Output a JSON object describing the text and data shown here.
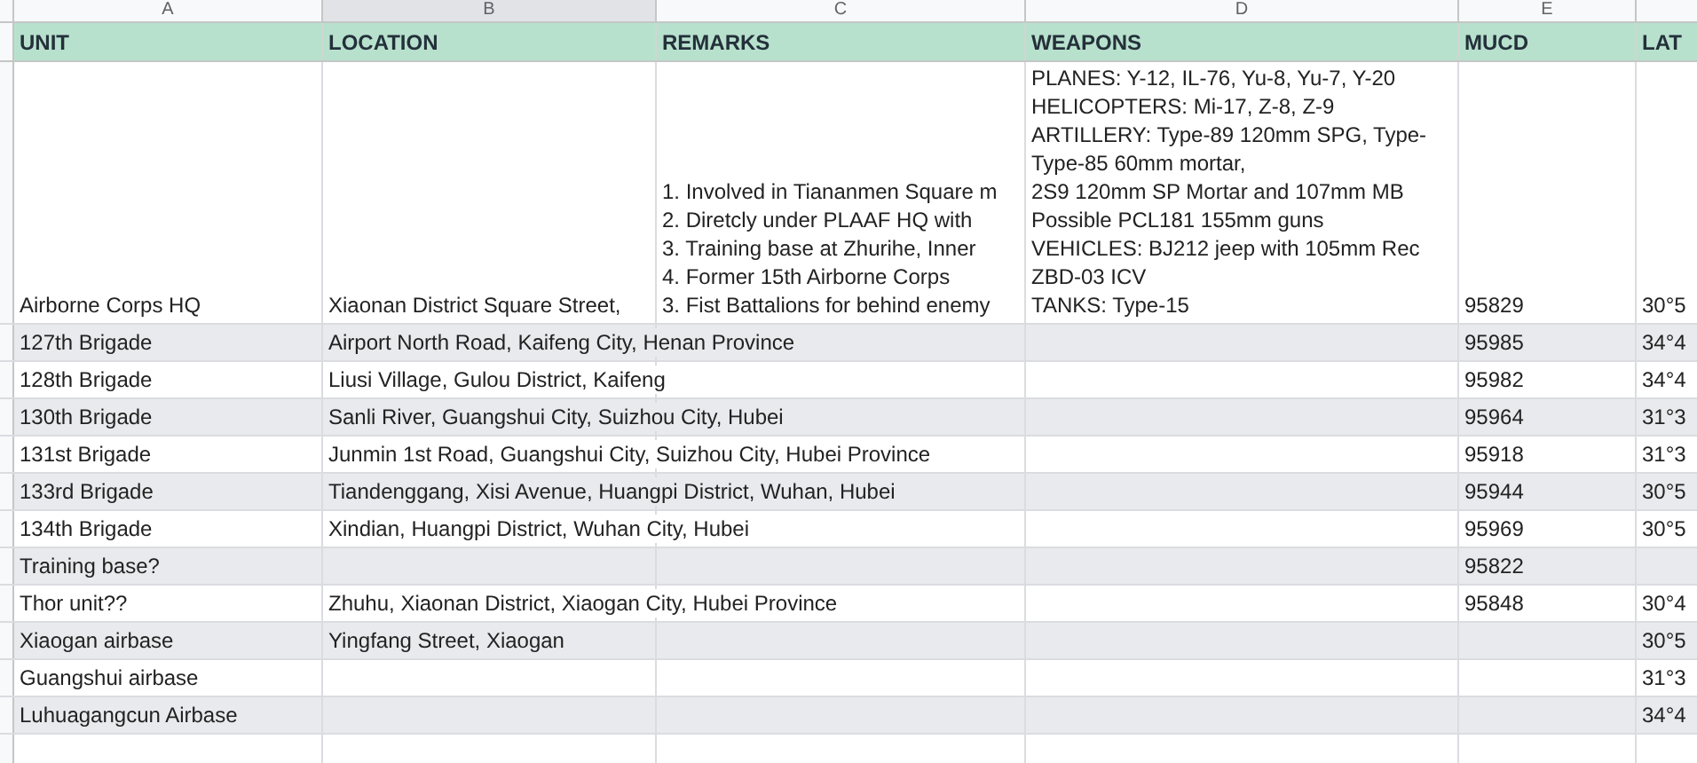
{
  "column_letters": [
    {
      "label": "A",
      "selected": false
    },
    {
      "label": "B",
      "selected": true
    },
    {
      "label": "C",
      "selected": false
    },
    {
      "label": "D",
      "selected": false
    },
    {
      "label": "E",
      "selected": false
    }
  ],
  "header": [
    "UNIT",
    "LOCATION",
    "REMARKS",
    "WEAPONS",
    "MUCD",
    "LAT"
  ],
  "rows": [
    {
      "unit": "Airborne Corps HQ",
      "location": "Xiaonan District Square Street,",
      "remarks": "1. Involved in Tiananmen Square m\n2. Diretcly under PLAAF HQ with\n3. Training base at Zhurihe, Inner\n4. Former 15th Airborne Corps\n3. Fist Battalions for behind enemy",
      "weapons": "PLANES: Y-12, IL-76, Yu-8, Yu-7, Y-20\nHELICOPTERS: Mi-17, Z-8, Z-9\nARTILLERY: Type-89 120mm SPG, Type-\nType-85 60mm mortar,\n2S9 120mm SP Mortar and 107mm MB\nPossible PCL181 155mm guns\nVEHICLES: BJ212 jeep with 105mm Rec\nZBD-03 ICV\nTANKS: Type-15",
      "mucd": "95829",
      "lat": "30°5"
    },
    {
      "unit": "127th Brigade",
      "location": "Airport North Road, Kaifeng City, Henan Province",
      "mucd": "95985",
      "lat": "34°4"
    },
    {
      "unit": "128th Brigade",
      "location": "Liusi Village, Gulou District, Kaifeng",
      "mucd": "95982",
      "lat": "34°4"
    },
    {
      "unit": "130th Brigade",
      "location": "Sanli River, Guangshui City, Suizhou City, Hubei",
      "mucd": "95964",
      "lat": "31°3"
    },
    {
      "unit": "131st Brigade",
      "location": "Junmin 1st Road, Guangshui City, Suizhou City, Hubei Province",
      "mucd": "95918",
      "lat": "31°3"
    },
    {
      "unit": "133rd Brigade",
      "location": "Tiandenggang, Xisi Avenue, Huangpi District, Wuhan, Hubei",
      "mucd": "95944",
      "lat": "30°5"
    },
    {
      "unit": "134th Brigade",
      "location": "Xindian, Huangpi District, Wuhan City, Hubei",
      "mucd": "95969",
      "lat": "30°5"
    },
    {
      "unit": "Training base?",
      "mucd": "95822"
    },
    {
      "unit": "Thor unit??",
      "location": "Zhuhu, Xiaonan District, Xiaogan City, Hubei Province",
      "mucd": "95848",
      "lat": "30°4"
    },
    {
      "unit": "Xiaogan airbase",
      "location": "Yingfang Street, Xiaogan",
      "lat": "30°5"
    },
    {
      "unit": "Guangshui airbase",
      "lat": "31°3"
    },
    {
      "unit": "Luhuagangcun Airbase",
      "lat": "34°4"
    }
  ]
}
